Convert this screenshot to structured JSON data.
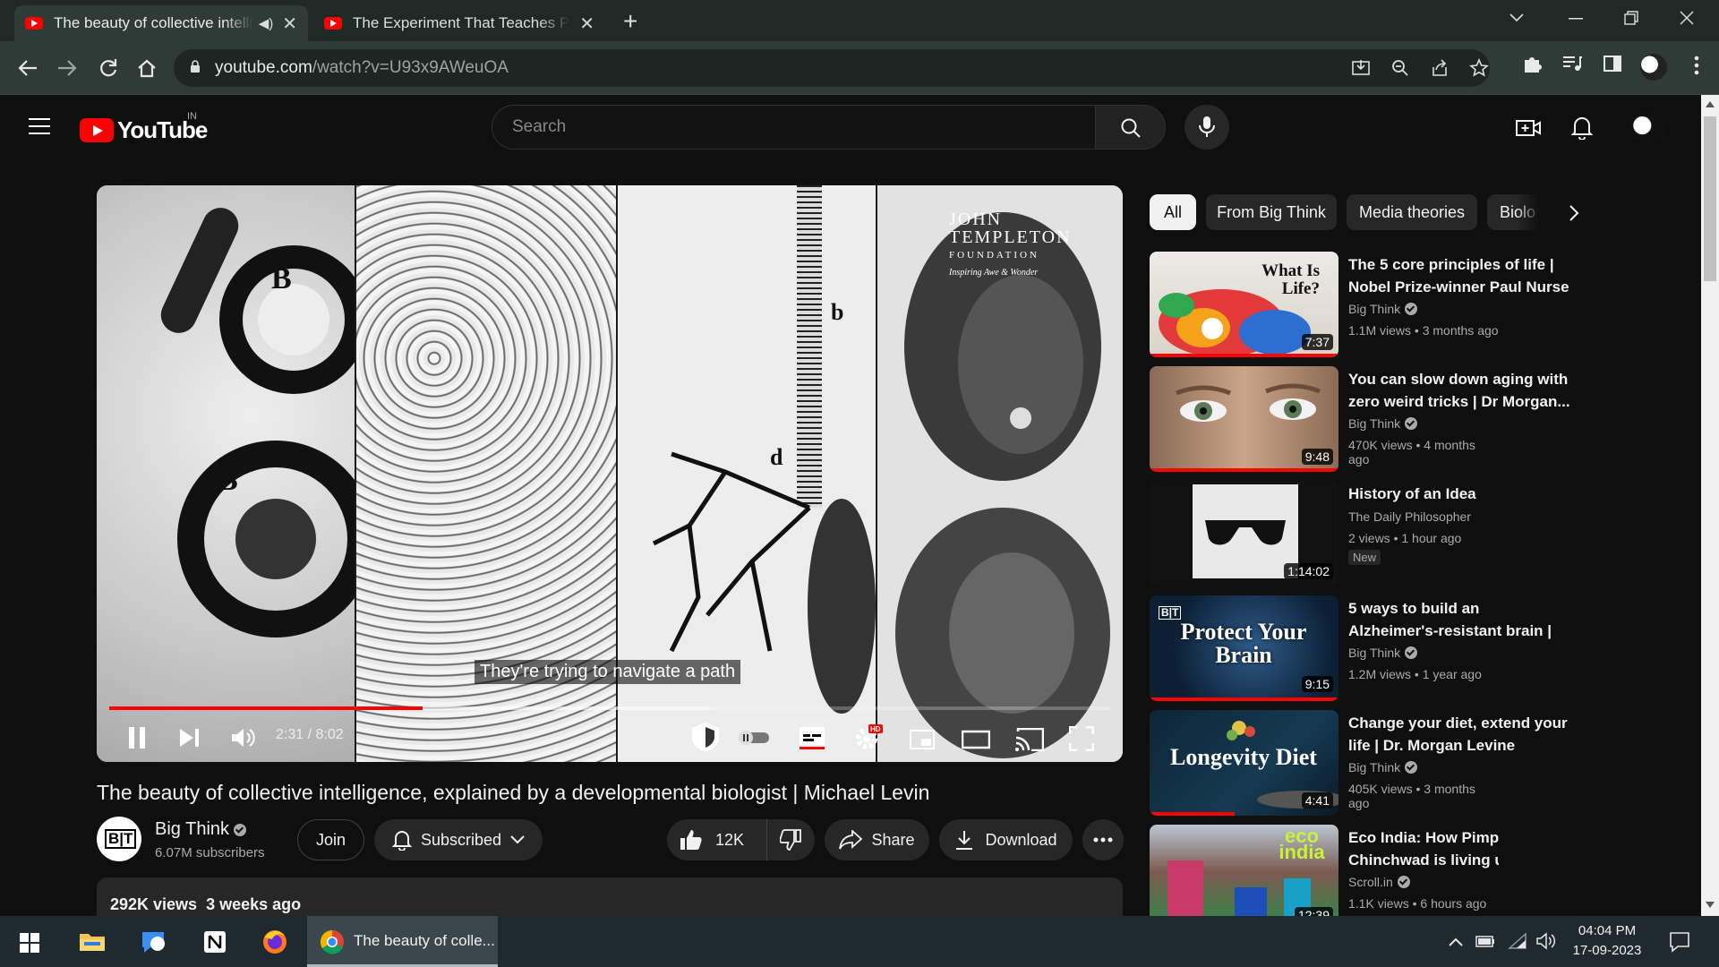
{
  "browser": {
    "tabs": [
      {
        "title": "The beauty of collective intelligence",
        "audio": "speaker-icon",
        "active": true
      },
      {
        "title": "The Experiment That Teaches People",
        "active": false
      }
    ],
    "new_tab": "+",
    "address": {
      "host": "youtube.com",
      "path": "/watch?v=U93x9AWeuOA"
    }
  },
  "youtube": {
    "logo": "YouTube",
    "country": "IN",
    "search": {
      "placeholder": "Search"
    },
    "filter_chips": [
      "All",
      "From Big Think",
      "Media theories",
      "Biolo"
    ],
    "player": {
      "caption": "They're trying to navigate a path",
      "watermark": {
        "line1": "JOHN",
        "line2": "TEMPLETON",
        "line3": "FOUNDATION",
        "line4": "Inspiring Awe & Wonder"
      },
      "current_time": "2:31",
      "duration": "8:02",
      "time_display": "2:31 / 8:02",
      "progress": 0.313,
      "hd_badge": "HD"
    },
    "video": {
      "title": "The beauty of collective intelligence, explained by a developmental biologist | Michael Levin",
      "channel": "Big Think",
      "channel_avatar": "B|T",
      "subscribers": "6.07M subscribers",
      "join": "Join",
      "subscribed": "Subscribed",
      "likes": "12K",
      "share": "Share",
      "download": "Download",
      "views": "292K views",
      "age": "3 weeks ago"
    },
    "recommendations": [
      {
        "title": "The 5 core principles of life | Nobel Prize-winner Paul Nurse",
        "channel": "Big Think",
        "verified": true,
        "views": "1.1M views",
        "age": "3 months ago",
        "duration": "7:37",
        "thumb_text": "What Is Life?",
        "watched": 1.0
      },
      {
        "title": "You can slow down aging with zero weird tricks | Dr Morgan...",
        "channel": "Big Think",
        "verified": true,
        "views": "470K views",
        "age": "4 months ago",
        "duration": "9:48",
        "watched": 1.0
      },
      {
        "title": "History of an Idea",
        "channel": "The Daily Philosopher",
        "verified": false,
        "views": "2 views",
        "age": "1 hour ago",
        "duration": "1:14:02",
        "badge": "New"
      },
      {
        "title": "5 ways to build an Alzheimer's-resistant brain | Lisa Genova",
        "channel": "Big Think",
        "verified": true,
        "views": "1.2M views",
        "age": "1 year ago",
        "duration": "9:15",
        "thumb_text": "Protect Your Brain",
        "thumb_badge": "B|T",
        "watched": 1.0
      },
      {
        "title": "Change your diet, extend your life | Dr. Morgan Levine",
        "channel": "Big Think",
        "verified": true,
        "views": "405K views",
        "age": "3 months ago",
        "duration": "4:41",
        "thumb_text": "Longevity Diet",
        "watched": 0.45
      },
      {
        "title": "Eco India: How Pimpri-Chinchwad is living up to its...",
        "channel": "Scroll.in",
        "verified": true,
        "views": "1.1K views",
        "age": "6 hours ago",
        "duration": "12:39",
        "thumb_text": "eco india"
      }
    ]
  },
  "taskbar": {
    "active_app_title": "The beauty of colle...",
    "time": "04:04 PM",
    "date": "17-09-2023"
  },
  "colors": {
    "brand_red": "#ff0000",
    "chrome_frame": "#1f2a26",
    "chrome_toolbar": "#2e3b36",
    "yt_bg": "#0f0f0f"
  }
}
